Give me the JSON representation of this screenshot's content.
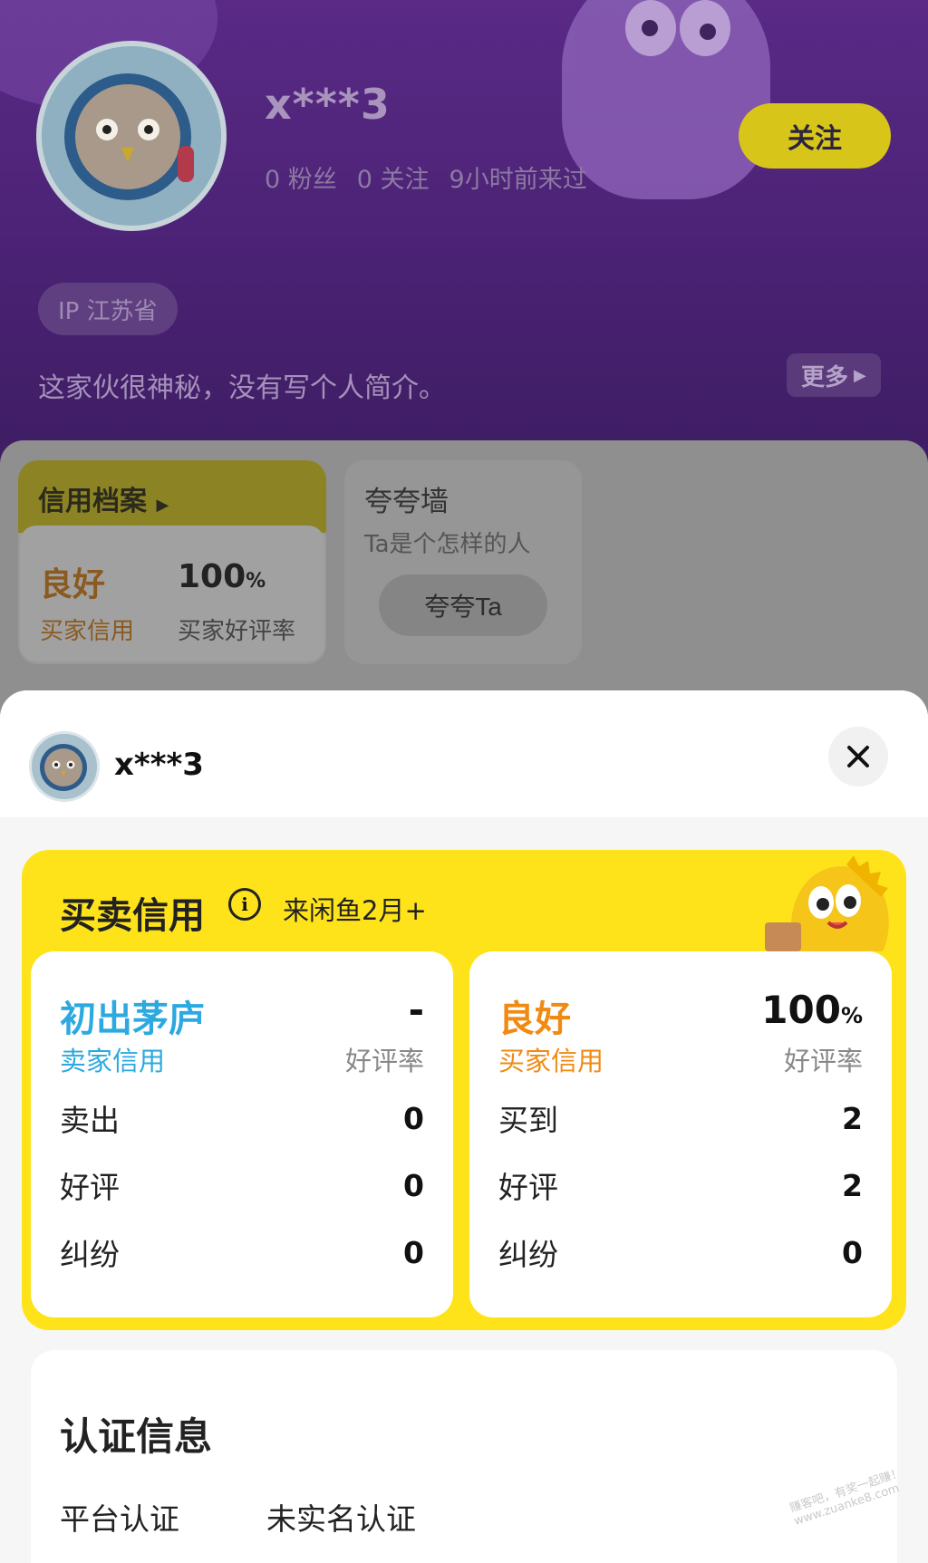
{
  "profile": {
    "username": "x***3",
    "fans": "0 粉丝",
    "following": "0 关注",
    "last_seen": "9小时前来过",
    "follow_label": "关注",
    "ip": "IP 江苏省",
    "bio": "这家伙很神秘，没有写个人简介。",
    "more_label": "更多",
    "credit_file": {
      "title": "信用档案",
      "level": "良好",
      "level_type": "买家信用",
      "rate": "100",
      "rate_unit": "%",
      "rate_label": "买家好评率"
    },
    "praise_wall": {
      "title": "夸夸墙",
      "subtitle": "Ta是个怎样的人",
      "button_label": "夸夸Ta"
    }
  },
  "sheet": {
    "username": "x***3",
    "credit_title": "买卖信用",
    "member_duration": "来闲鱼2月+",
    "seller": {
      "level": "初出茅庐",
      "type": "卖家信用",
      "rate": "-",
      "rate_label": "好评率",
      "stats": [
        {
          "label": "卖出",
          "value": "0"
        },
        {
          "label": "好评",
          "value": "0"
        },
        {
          "label": "纠纷",
          "value": "0"
        }
      ]
    },
    "buyer": {
      "level": "良好",
      "type": "买家信用",
      "rate": "100",
      "rate_unit": "%",
      "rate_label": "好评率",
      "stats": [
        {
          "label": "买到",
          "value": "2"
        },
        {
          "label": "好评",
          "value": "2"
        },
        {
          "label": "纠纷",
          "value": "0"
        }
      ]
    },
    "cert": {
      "title": "认证信息",
      "platform_label": "平台认证",
      "platform_value": "未实名认证"
    }
  },
  "watermark": "赚客吧，有奖一起赚！ www.zuanke8.com",
  "colors": {
    "header_purple": "#4a2274",
    "accent_yellow": "#ffe31a",
    "seller_blue": "#2ba9e0",
    "buyer_orange": "#f08a12"
  }
}
